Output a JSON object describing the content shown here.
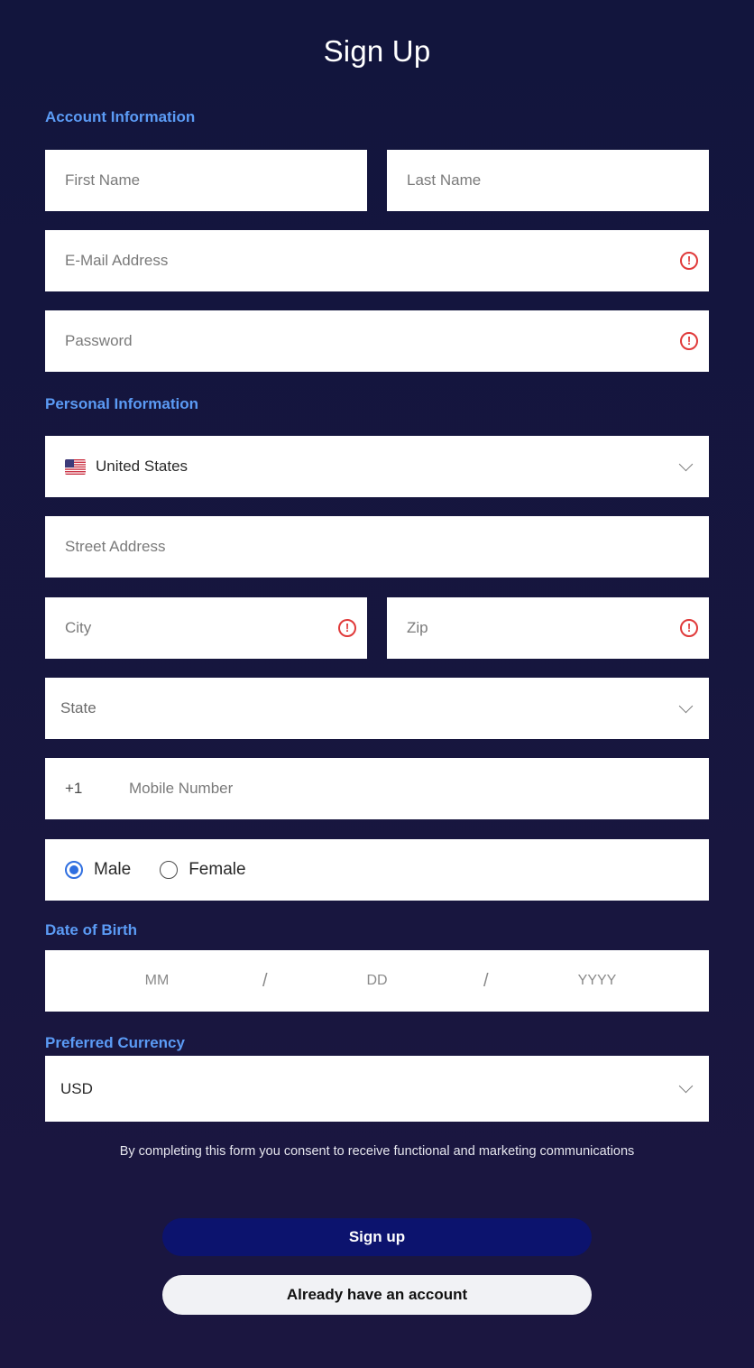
{
  "title": "Sign Up",
  "sections": {
    "account": "Account Information",
    "personal": "Personal Information",
    "dob": "Date of Birth",
    "currency": "Preferred Currency"
  },
  "fields": {
    "first_name": {
      "placeholder": "First Name",
      "value": ""
    },
    "last_name": {
      "placeholder": "Last Name",
      "value": ""
    },
    "email": {
      "placeholder": "E-Mail Address",
      "value": ""
    },
    "password": {
      "placeholder": "Password",
      "value": ""
    },
    "country": {
      "value": "United States",
      "flag": "us-flag-icon"
    },
    "street": {
      "placeholder": "Street Address",
      "value": ""
    },
    "city": {
      "placeholder": "City",
      "value": ""
    },
    "zip": {
      "placeholder": "Zip",
      "value": ""
    },
    "state": {
      "placeholder": "State"
    },
    "phone": {
      "prefix": "+1",
      "placeholder": "Mobile Number",
      "value": ""
    },
    "gender": {
      "options": [
        "Male",
        "Female"
      ],
      "selected": "Male"
    },
    "dob": {
      "month": "MM",
      "day": "DD",
      "year": "YYYY",
      "separator": "/"
    },
    "currency": {
      "value": "USD"
    }
  },
  "error_icon": {
    "name": "error-icon",
    "glyph": "!",
    "color": "#e03a3a"
  },
  "consent_text": "By completing this form you consent to receive functional and marketing communications",
  "buttons": {
    "signup": "Sign up",
    "login": "Already have an account"
  },
  "colors": {
    "background": "#12153d",
    "section_label": "#5b9bf5",
    "primary_button": "#0c136e",
    "secondary_button": "#f1f2f5",
    "radio_selected": "#2f6fe0"
  }
}
